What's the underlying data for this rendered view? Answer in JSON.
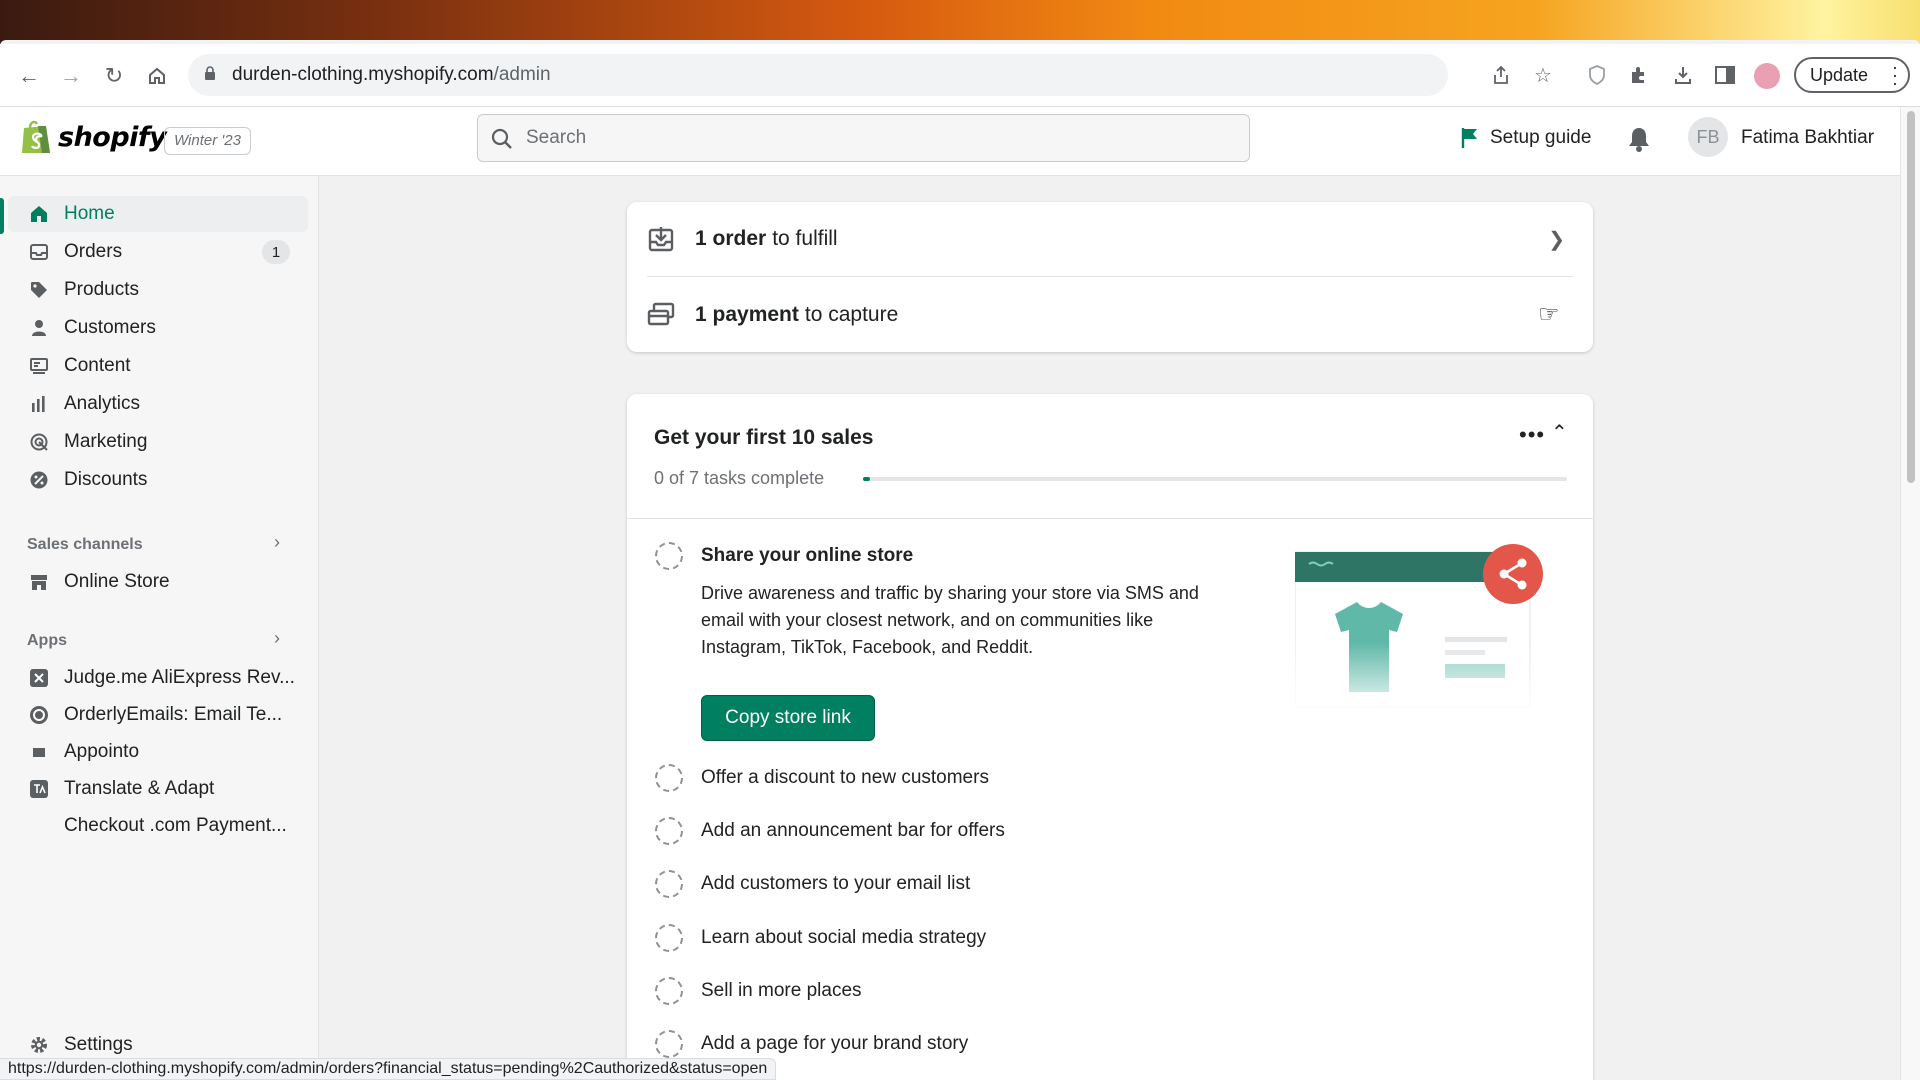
{
  "browser": {
    "url_host": "durden-clothing.myshopify.com",
    "url_path": "/admin",
    "update_label": "Update",
    "status_url": "https://durden-clothing.myshopify.com/admin/orders?financial_status=pending%2Cauthorized&status=open"
  },
  "topbar": {
    "brand": "shopify",
    "edition": "Winter '23",
    "search_placeholder": "Search",
    "setup_guide": "Setup guide",
    "user_initials": "FB",
    "user_name": "Fatima Bakhtiar"
  },
  "sidebar": {
    "items": [
      {
        "label": "Home",
        "icon": "home-icon"
      },
      {
        "label": "Orders",
        "icon": "inbox-icon",
        "badge": "1"
      },
      {
        "label": "Products",
        "icon": "tag-icon"
      },
      {
        "label": "Customers",
        "icon": "person-icon"
      },
      {
        "label": "Content",
        "icon": "content-icon"
      },
      {
        "label": "Analytics",
        "icon": "bar-chart-icon"
      },
      {
        "label": "Marketing",
        "icon": "target-icon"
      },
      {
        "label": "Discounts",
        "icon": "discount-icon"
      }
    ],
    "sales_channels_heading": "Sales channels",
    "sales_channels": [
      {
        "label": "Online Store",
        "icon": "store-icon"
      }
    ],
    "apps_heading": "Apps",
    "apps": [
      {
        "label": "Judge.me AliExpress Rev..."
      },
      {
        "label": "OrderlyEmails: Email Te..."
      },
      {
        "label": "Appointo"
      },
      {
        "label": "Translate & Adapt"
      },
      {
        "label": "Checkout .com Payment..."
      }
    ],
    "settings": "Settings"
  },
  "tasks_card": {
    "rows": [
      {
        "strong": "1 order",
        "rest": "to fulfill"
      },
      {
        "strong": "1 payment",
        "rest": "to capture"
      }
    ]
  },
  "sales_card": {
    "title": "Get your first 10 sales",
    "progress_text": "0 of 7 tasks complete",
    "progress_fraction": 0.01,
    "expanded_task": {
      "title": "Share your online store",
      "description": "Drive awareness and traffic by sharing your store via SMS and email with your closest network, and on communities like Instagram, TikTok, Facebook, and Reddit.",
      "button": "Copy store link"
    },
    "tasks": [
      "Offer a discount to new customers",
      "Add an announcement bar for offers",
      "Add customers to your email list",
      "Learn about social media strategy",
      "Sell in more places",
      "Add a page for your brand story"
    ]
  },
  "colors": {
    "brand_green": "#008060",
    "share_red": "#e3574a",
    "illustration_teal": "#5fb8a8"
  }
}
